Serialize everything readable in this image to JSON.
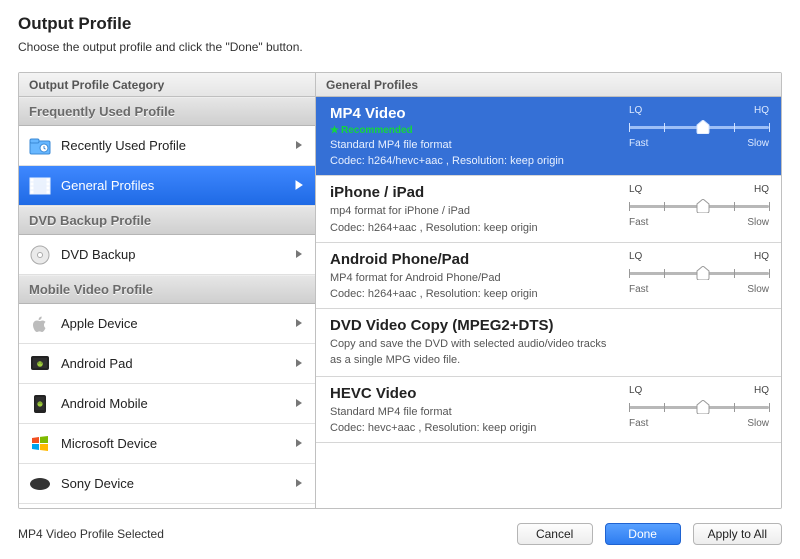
{
  "header": {
    "title": "Output Profile",
    "subtitle": "Choose the output profile and click the \"Done\" button."
  },
  "left": {
    "column_header": "Output Profile Category",
    "sections": [
      {
        "title": "Frequently Used Profile",
        "items": [
          {
            "key": "recent",
            "icon": "clock-folder",
            "label": "Recently Used Profile",
            "selected": false
          },
          {
            "key": "general",
            "icon": "film",
            "label": "General Profiles",
            "selected": true
          }
        ]
      },
      {
        "title": "DVD Backup Profile",
        "items": [
          {
            "key": "dvdbackup",
            "icon": "disc",
            "label": "DVD Backup",
            "selected": false
          }
        ]
      },
      {
        "title": "Mobile Video Profile",
        "items": [
          {
            "key": "apple",
            "icon": "apple",
            "label": "Apple Device",
            "selected": false
          },
          {
            "key": "androidpad",
            "icon": "android-tablet",
            "label": "Android Pad",
            "selected": false
          },
          {
            "key": "androidmobile",
            "icon": "android-phone",
            "label": "Android Mobile",
            "selected": false
          },
          {
            "key": "microsoft",
            "icon": "windows",
            "label": "Microsoft Device",
            "selected": false
          },
          {
            "key": "sony",
            "icon": "sony",
            "label": "Sony Device",
            "selected": false
          }
        ]
      }
    ]
  },
  "right": {
    "column_header": "General Profiles",
    "lq": "LQ",
    "hq": "HQ",
    "fast": "Fast",
    "slow": "Slow",
    "recommended_label": "Recommended",
    "profiles": [
      {
        "key": "mp4",
        "title": "MP4 Video",
        "recommended": true,
        "selected": true,
        "desc": "Standard MP4 file format",
        "codec": "Codec: h264/hevc+aac , Resolution: keep origin",
        "slider": 0.53,
        "has_slider": true
      },
      {
        "key": "iphone",
        "title": "iPhone / iPad",
        "recommended": false,
        "selected": false,
        "desc": "mp4 format for iPhone / iPad",
        "codec": "Codec: h264+aac , Resolution: keep origin",
        "slider": 0.53,
        "has_slider": true
      },
      {
        "key": "android",
        "title": "Android Phone/Pad",
        "recommended": false,
        "selected": false,
        "desc": "MP4 format for Android Phone/Pad",
        "codec": "Codec: h264+aac , Resolution: keep origin",
        "slider": 0.53,
        "has_slider": true
      },
      {
        "key": "dvdcopy",
        "title": "DVD Video Copy (MPEG2+DTS)",
        "recommended": false,
        "selected": false,
        "desc": "Copy and save the DVD with selected audio/video tracks\n as a single MPG video file.",
        "codec": "",
        "slider": 0,
        "has_slider": false
      },
      {
        "key": "hevc",
        "title": "HEVC Video",
        "recommended": false,
        "selected": false,
        "desc": "Standard MP4 file format",
        "codec": "Codec: hevc+aac , Resolution: keep origin",
        "slider": 0.53,
        "has_slider": true
      }
    ]
  },
  "footer": {
    "status": "MP4 Video Profile Selected",
    "cancel": "Cancel",
    "done": "Done",
    "apply": "Apply to All"
  }
}
